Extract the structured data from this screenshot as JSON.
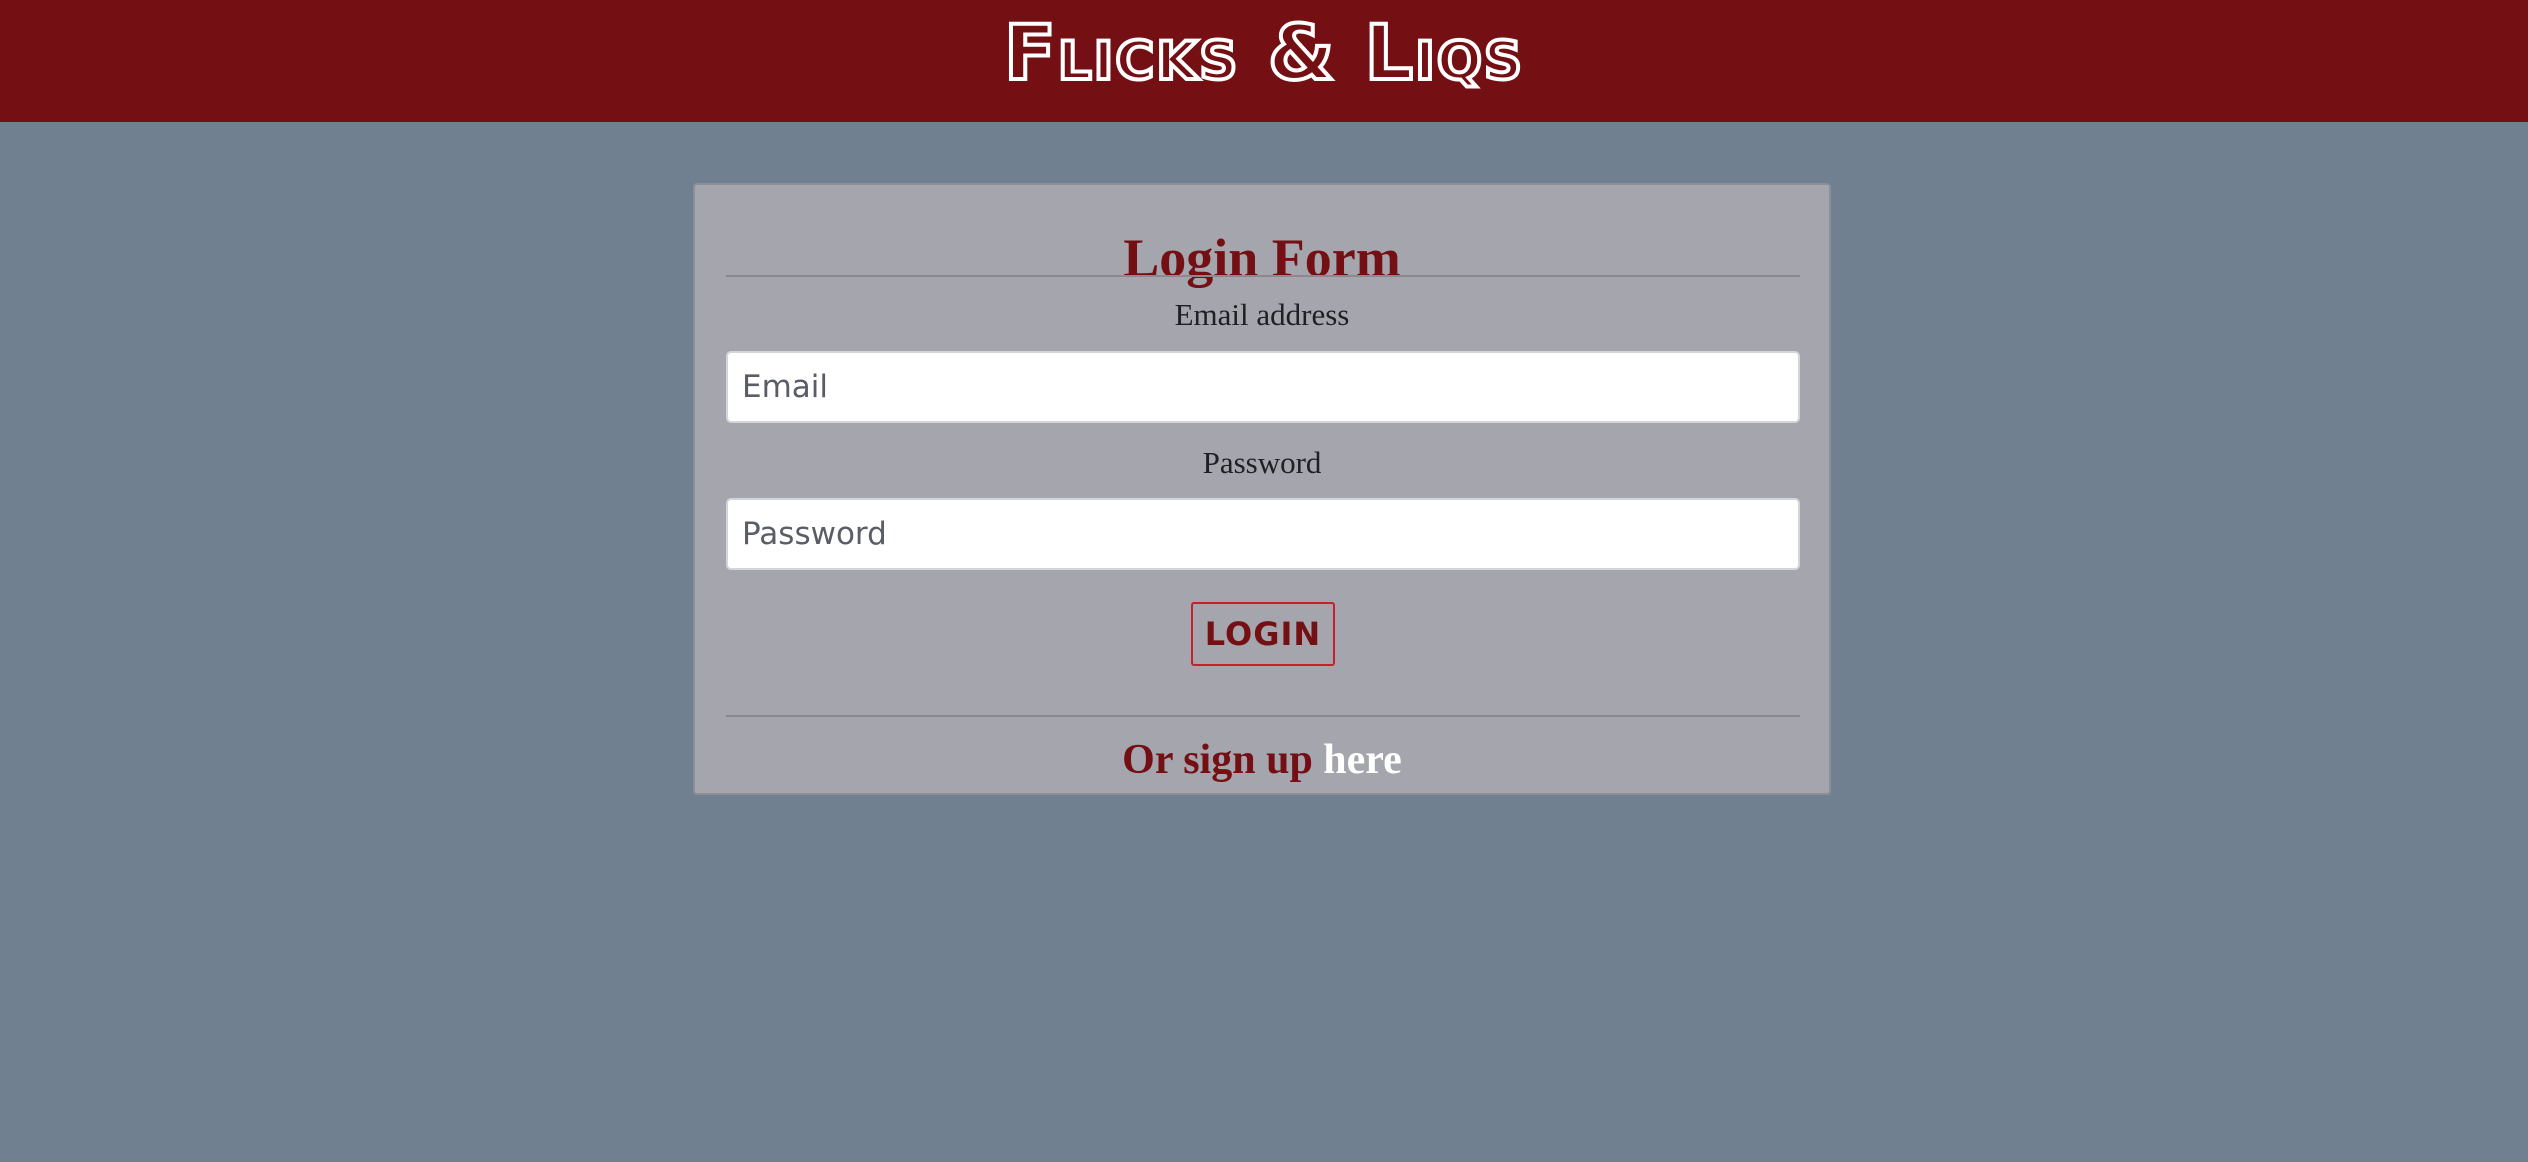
{
  "header": {
    "brand": "Flicks & Liqs"
  },
  "login_form": {
    "title": "Login Form",
    "email": {
      "label": "Email address",
      "placeholder": "Email",
      "value": ""
    },
    "password": {
      "label": "Password",
      "placeholder": "Password",
      "value": ""
    },
    "submit_label": "LOGIN",
    "signup_prefix": "Or sign up",
    "signup_link": "here"
  },
  "colors": {
    "navbar": "#740f14",
    "page_background": "#708090",
    "card_background": "#a4a5ad",
    "accent": "#740f14",
    "button_border": "#c8202a",
    "link": "#ffffff"
  }
}
